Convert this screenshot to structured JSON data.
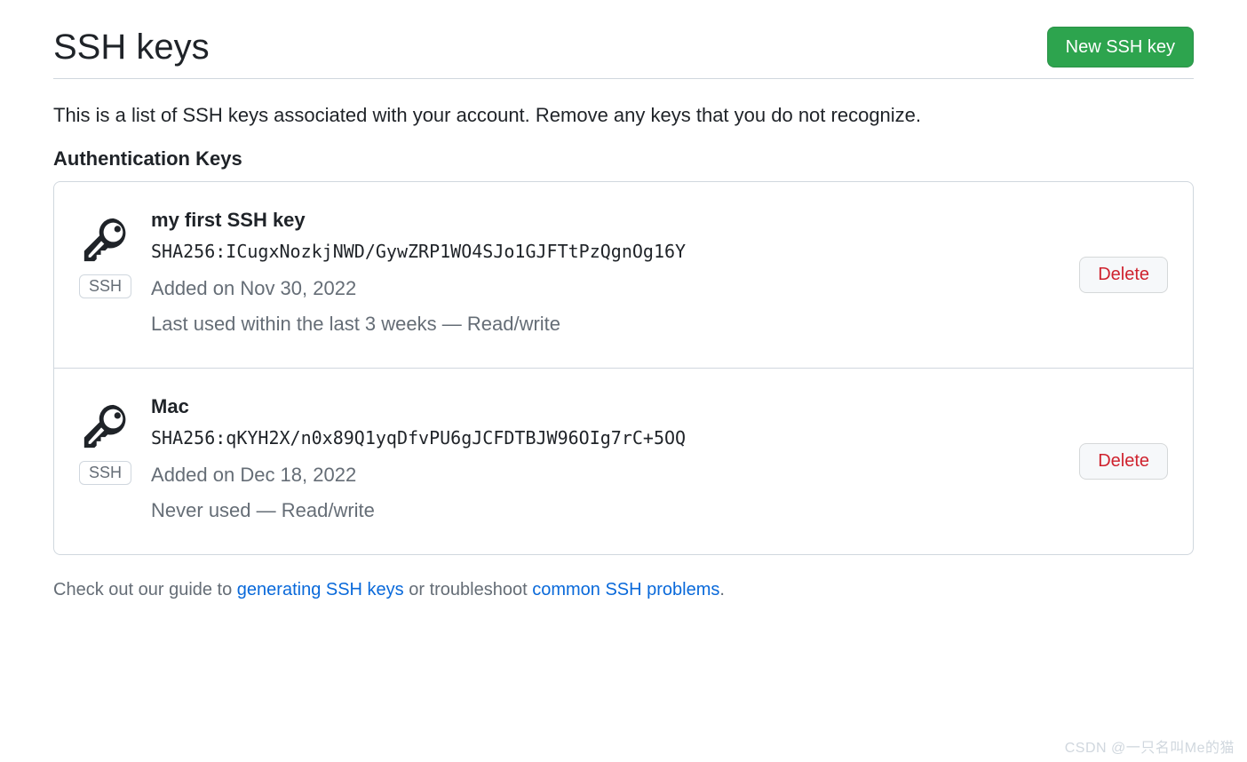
{
  "header": {
    "title": "SSH keys",
    "newButton": "New SSH key"
  },
  "description": "This is a list of SSH keys associated with your account. Remove any keys that you do not recognize.",
  "sectionHeading": "Authentication Keys",
  "deleteLabel": "Delete",
  "sshBadge": "SSH",
  "keys": [
    {
      "name": "my first SSH key",
      "fingerprint": "SHA256:ICugxNozkjNWD/GywZRP1WO4SJo1GJFTtPzQgnOg16Y",
      "added": "Added on Nov 30, 2022",
      "usage": "Last used within the last 3 weeks — Read/write"
    },
    {
      "name": "Mac",
      "fingerprint": "SHA256:qKYH2X/n0x89Q1yqDfvPU6gJCFDTBJW96OIg7rC+5OQ",
      "added": "Added on Dec 18, 2022",
      "usage": "Never used — Read/write"
    }
  ],
  "footer": {
    "prefix": "Check out our guide to ",
    "link1": "generating SSH keys",
    "middle": " or troubleshoot ",
    "link2": "common SSH problems",
    "suffix": "."
  },
  "watermark": "CSDN @一只名叫Me的猫"
}
